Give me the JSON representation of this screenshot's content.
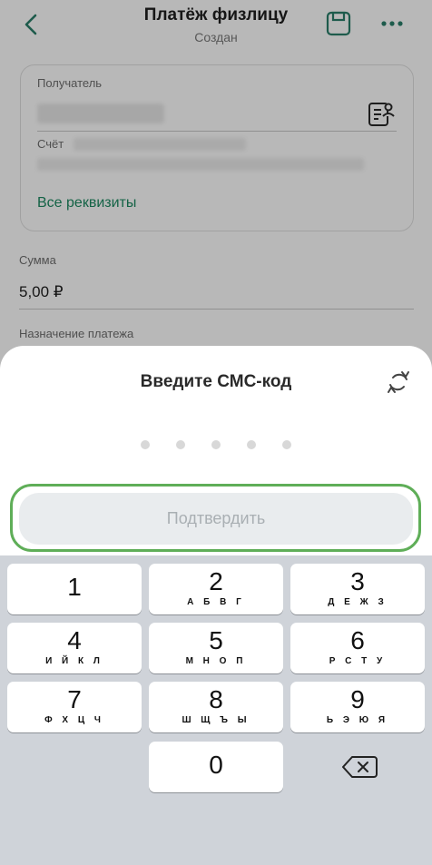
{
  "header": {
    "title": "Платёж физлицу",
    "status": "Создан",
    "back_icon": "chevron-left-icon",
    "save_icon": "floppy-disk-icon",
    "more_icon": "more-horizontal-icon"
  },
  "recipient": {
    "label": "Получатель",
    "account_label": "Счёт",
    "all_details_link": "Все реквизиты",
    "contact_icon": "contact-book-icon"
  },
  "amount": {
    "label": "Сумма",
    "value": "5,00 ₽"
  },
  "purpose": {
    "label": "Назначение платежа"
  },
  "sms_sheet": {
    "title": "Введите СМС-код",
    "resend_icon": "refresh-icon",
    "code_length": 5,
    "entered_digits": 0,
    "confirm_label": "Подтвердить"
  },
  "keypad": {
    "keys": [
      {
        "digit": "1",
        "letters": ""
      },
      {
        "digit": "2",
        "letters": "А Б В Г"
      },
      {
        "digit": "3",
        "letters": "Д Е Ж З"
      },
      {
        "digit": "4",
        "letters": "И Й К Л"
      },
      {
        "digit": "5",
        "letters": "М Н О П"
      },
      {
        "digit": "6",
        "letters": "Р С Т У"
      },
      {
        "digit": "7",
        "letters": "Ф Х Ц Ч"
      },
      {
        "digit": "8",
        "letters": "Ш Щ Ъ Ы"
      },
      {
        "digit": "9",
        "letters": "Ь Э Ю Я"
      },
      {
        "digit": "0",
        "letters": ""
      }
    ],
    "backspace_icon": "backspace-icon"
  },
  "colors": {
    "accent_green": "#1c8a62",
    "highlight_green": "#5fae58",
    "keypad_bg": "#cfd3d9",
    "disabled_button_bg": "#e9ecee"
  }
}
